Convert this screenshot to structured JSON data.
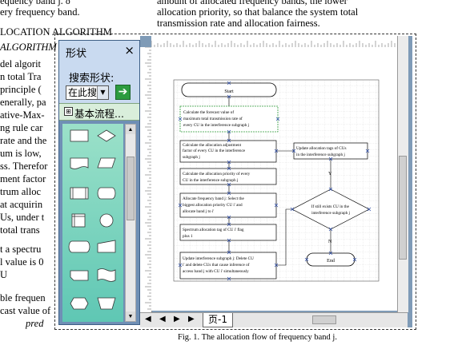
{
  "document": {
    "left_lines": [
      "equency band j. δ",
      "ery frequency band.",
      "LOCATION ALGORITHM",
      "ALGORITHM",
      "del algorit",
      "n total Tra",
      "principle (",
      "enerally, pa",
      "ative-Max-",
      "ng rule car",
      "rate and the",
      "um is low,",
      "ss. Therefor",
      "ment factor",
      "trum alloc",
      "at acquirin",
      "Us, under t",
      "total trans",
      "t a spectru",
      "l value is 0",
      "U",
      "ble frequen",
      "cast value of",
      "pred"
    ],
    "right_lines": [
      "amount of allocated frequency bands, the lower",
      "allocation priority, so that balance the system total",
      "transmission rate and allocation fairness."
    ],
    "caption": "Fig. 1.      The allocation flow of frequency band j."
  },
  "shapes_panel": {
    "title": "形状",
    "close": "×",
    "search_label": "搜索形状:",
    "search_scope": "在此搜",
    "dropdown_arrow": "▼",
    "go_icon": "➔",
    "stencil_name": "基本流程...",
    "stencil_icon": "⊞"
  },
  "flowchart": {
    "start": "Start",
    "step1": [
      "Calculate the forecast value of",
      "maximum total transmission rate of",
      "every CU in the interference subgraph j"
    ],
    "step2": [
      "Calculate the allocation adjustment",
      "factor of every CU in the interference",
      "subgraph j"
    ],
    "step3": [
      "Calculate the allocation priority of every",
      "CU in the interference subgraph j"
    ],
    "step4": [
      "Allocate frequency band j: Select the",
      "biggest allocation priority CU i' and",
      "allocate band j to i'"
    ],
    "step5": [
      "Spectrum allocation tag of CU i' flag",
      "plus 1"
    ],
    "step6": [
      "Update interference subgraph j: Delete CU",
      "i' and delete CUs that cause inference of",
      "access band j with CU i' simultaneously"
    ],
    "update": [
      "Update allocation tags of CUs",
      "in the interference subgraph j"
    ],
    "decision": [
      "If still exists CU in the",
      "interference subgraph j"
    ],
    "yes": "Y",
    "no": "N",
    "end": "End"
  },
  "bottom_bar": {
    "first": "◀",
    "prev": "◀",
    "next": "▶",
    "last": "▶",
    "page_tab": "页-1"
  },
  "colors": {
    "canvas_bg": "#7f9bb7",
    "panel_bg": "#6f8fb5",
    "shapes_bg": "#6fcdb9",
    "go_button": "#2c9b3f"
  }
}
